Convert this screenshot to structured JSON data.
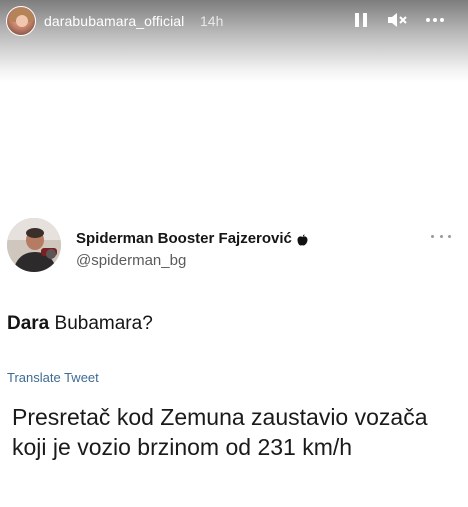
{
  "story": {
    "username": "darabubamara_official",
    "time": "14h"
  },
  "tweet": {
    "display_name": "Spiderman Booster Fajzerović",
    "handle": "@spiderman_bg",
    "text_bold": "Dara",
    "text_rest": " Bubamara?",
    "translate_label": "Translate Tweet",
    "quoted_text": "Presretač kod Zemuna zaustavio vozača koji je vozio brzinom od 231 km/h"
  },
  "icons": {
    "pause": "pause-icon",
    "mute": "mute-icon",
    "more": "more-icon",
    "verified": "apple-icon"
  },
  "colors": {
    "link": "#3d6b94",
    "text": "#151515",
    "handle": "#5b5b5b"
  }
}
